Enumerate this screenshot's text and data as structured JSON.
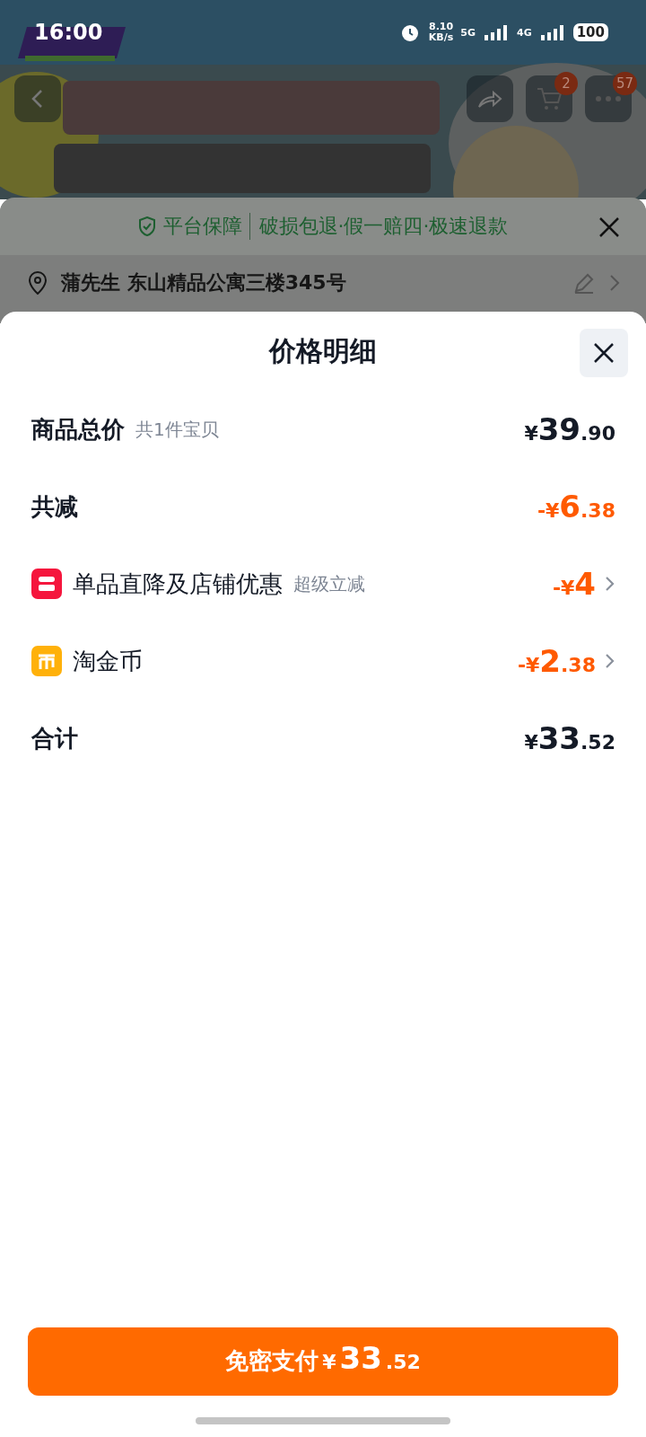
{
  "status_bar": {
    "time": "16:00",
    "speed_value": "8.10",
    "speed_unit": "KB/s",
    "network_1": "5G",
    "network_2": "4G",
    "battery": "100"
  },
  "product_header": {
    "badges": [
      {
        "kind": "cart",
        "count": "2"
      },
      {
        "kind": "more",
        "count": "57"
      }
    ]
  },
  "order_page": {
    "guarantee": {
      "label": "平台保障",
      "text": "破损包退·假一赔四·极速退款"
    },
    "address": "蒲先生 东山精品公寓三楼345号"
  },
  "price_sheet": {
    "title": "价格明细",
    "rows": [
      {
        "kind": "main",
        "label": "商品总价",
        "note": "共1件宝贝",
        "sign": "¥",
        "integer": "39",
        "fraction": ".90"
      },
      {
        "kind": "discount",
        "label": "共减",
        "sign": "-¥",
        "integer": "6",
        "fraction": ".38"
      },
      {
        "kind": "shop",
        "label": "单品直降及店铺优惠",
        "note": "超级立减",
        "sign": "-¥",
        "integer": "4",
        "color": "#f5163d"
      },
      {
        "kind": "coin",
        "label": "淘金币",
        "sign": "-¥",
        "integer": "2",
        "fraction": ".38",
        "color": "#ffb10a"
      },
      {
        "kind": "main",
        "label": "合计",
        "sign": "¥",
        "integer": "33",
        "fraction": ".52"
      }
    ],
    "pay_button": {
      "label": "免密支付",
      "sign": "¥",
      "integer": "33",
      "fraction": ".52"
    }
  }
}
